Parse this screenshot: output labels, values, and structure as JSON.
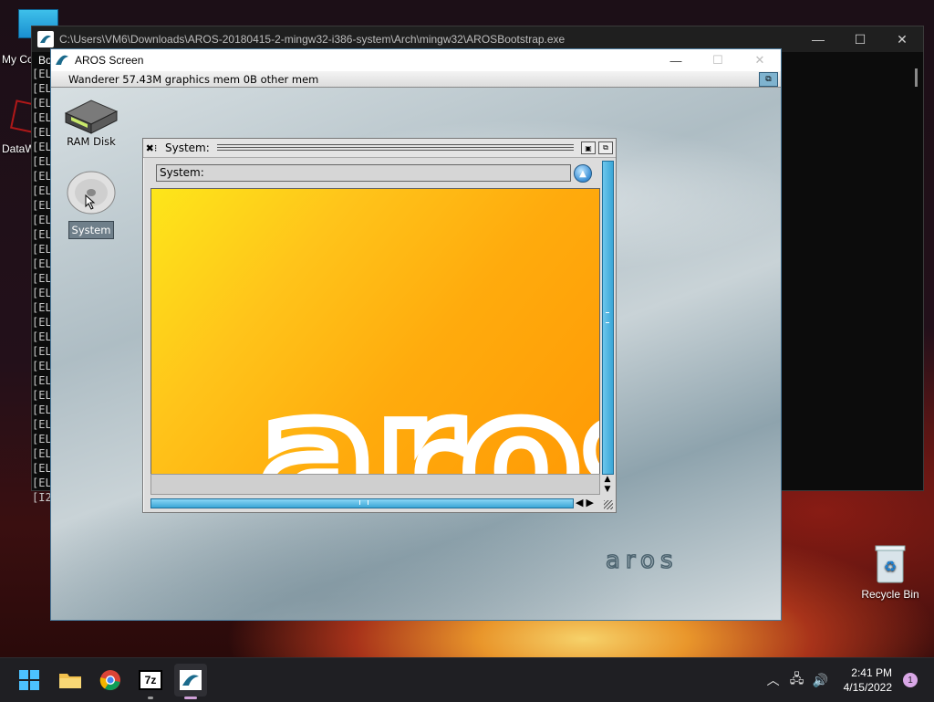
{
  "desktop": {
    "icons": [
      {
        "label": "My Co"
      },
      {
        "label": "DataW"
      },
      {
        "label": "Recycle Bin"
      }
    ]
  },
  "console": {
    "title": "C:\\Users\\VM6\\Downloads\\AROS-20180415-2-mingw32-i386-system\\Arch\\mingw32\\AROSBootstrap.exe",
    "partial_text": "Bo",
    "lines": [
      "[EL",
      "[EL",
      "[EL",
      "[EL",
      "[EL",
      "[EL",
      "[EL",
      "[EL",
      "[EL",
      "[EL",
      "[EL",
      "[EL",
      "[EL",
      "[EL",
      "[EL",
      "[EL",
      "[EL",
      "[EL",
      "[EL",
      "[EL",
      "[EL",
      "[EL",
      "[EL",
      "[EL",
      "[EL",
      "[EL",
      "[EL",
      "[EL",
      "[EL",
      "[I2"
    ],
    "controls": {
      "minimize": "—",
      "maximize": "☐",
      "close": "✕"
    }
  },
  "aros_window": {
    "title": "AROS Screen",
    "controls": {
      "minimize": "—",
      "maximize": "☐",
      "close": "✕"
    },
    "wanderer_status": "Wanderer 57.43M graphics mem 0B other mem",
    "icons": [
      {
        "label": "RAM Disk"
      },
      {
        "label": "System"
      }
    ],
    "logo_text": "aros"
  },
  "drawer": {
    "title": "System:",
    "path": "System:",
    "content_logo_text": "aros"
  },
  "taskbar": {
    "apps": [
      {
        "name": "start",
        "icon": "windows-start-icon"
      },
      {
        "name": "file-explorer",
        "icon": "folder-icon"
      },
      {
        "name": "chrome",
        "icon": "chrome-icon"
      },
      {
        "name": "7zip",
        "icon": "7zip-icon",
        "label": "7z"
      },
      {
        "name": "aros",
        "icon": "aros-icon",
        "active": true
      }
    ],
    "time": "2:41 PM",
    "date": "4/15/2022",
    "notifications": "1"
  }
}
